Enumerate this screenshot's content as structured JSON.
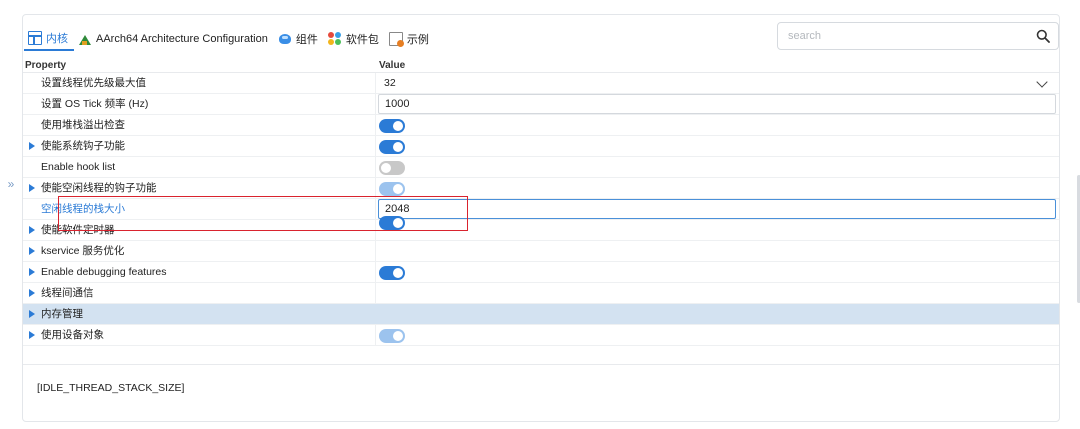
{
  "sidebar": {
    "collapse_glyph": "»"
  },
  "tabs": [
    {
      "label": "内核",
      "icon": "kernel-grid-icon",
      "active": true
    },
    {
      "label": "AArch64 Architecture Configuration",
      "icon": "architecture-icon",
      "active": false
    },
    {
      "label": "组件",
      "icon": "component-icon",
      "active": false
    },
    {
      "label": "软件包",
      "icon": "package-icon",
      "active": false
    },
    {
      "label": "示例",
      "icon": "example-icon",
      "active": false
    }
  ],
  "search": {
    "placeholder": "search",
    "value": ""
  },
  "grid": {
    "header": {
      "property": "Property",
      "value": "Value"
    },
    "rows": [
      {
        "label": "设置线程优先级最大值",
        "kind": "select",
        "value": "32",
        "expandable": false
      },
      {
        "label": "设置 OS Tick 频率 (Hz)",
        "kind": "text",
        "value": "1000",
        "expandable": false
      },
      {
        "label": "使用堆栈溢出检查",
        "kind": "toggle",
        "state": "on",
        "expandable": false
      },
      {
        "label": "使能系统钩子功能",
        "kind": "toggle",
        "state": "on",
        "expandable": true
      },
      {
        "label": "Enable hook list",
        "kind": "toggle",
        "state": "off",
        "expandable": false
      },
      {
        "label": "使能空闲线程的钩子功能",
        "kind": "toggle",
        "state": "disabled",
        "expandable": true
      },
      {
        "label": "空闲线程的栈大小",
        "kind": "text",
        "value": "2048",
        "expandable": false,
        "highlight": true
      },
      {
        "label": "使能软件定时器",
        "kind": "toggle",
        "state": "on",
        "expandable": true
      },
      {
        "label": "kservice 服务优化",
        "kind": "none",
        "expandable": true
      },
      {
        "label": "Enable debugging features",
        "kind": "toggle",
        "state": "on",
        "expandable": true
      },
      {
        "label": "线程间通信",
        "kind": "none",
        "expandable": true
      },
      {
        "label": "内存管理",
        "kind": "none",
        "expandable": true,
        "selected": true
      },
      {
        "label": "使用设备对象",
        "kind": "toggle",
        "state": "disabled",
        "expandable": true
      }
    ]
  },
  "description": {
    "text": "[IDLE_THREAD_STACK_SIZE]"
  },
  "colors": {
    "accent": "#2b7bd6",
    "selected_row": "#d3e2f1",
    "annotation": "#d9232e"
  }
}
